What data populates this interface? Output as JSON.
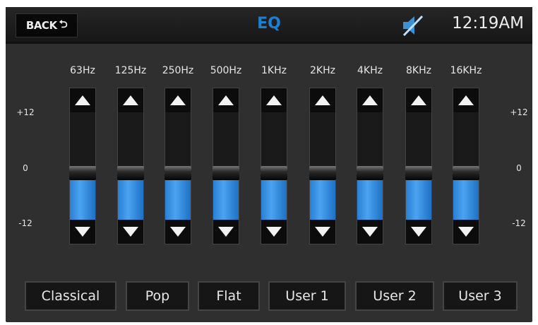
{
  "header": {
    "back_label": "BACK",
    "title": "EQ",
    "time": "12:19AM",
    "status_icon": "mute-icon"
  },
  "scale": {
    "top": "+12",
    "mid": "0",
    "bottom": "-12",
    "min": -12,
    "max": 12
  },
  "bands": [
    {
      "label": "63Hz",
      "value": 0
    },
    {
      "label": "125Hz",
      "value": 0
    },
    {
      "label": "250Hz",
      "value": 0
    },
    {
      "label": "500Hz",
      "value": 0
    },
    {
      "label": "1KHz",
      "value": 0
    },
    {
      "label": "2KHz",
      "value": 0
    },
    {
      "label": "4KHz",
      "value": 0
    },
    {
      "label": "8KHz",
      "value": 0
    },
    {
      "label": "16KHz",
      "value": 0
    }
  ],
  "presets": [
    "Classical",
    "Pop",
    "Flat",
    "User 1",
    "User 2",
    "User 3"
  ],
  "colors": {
    "accent": "#1e7fd0",
    "fill": "#3a92e4"
  }
}
